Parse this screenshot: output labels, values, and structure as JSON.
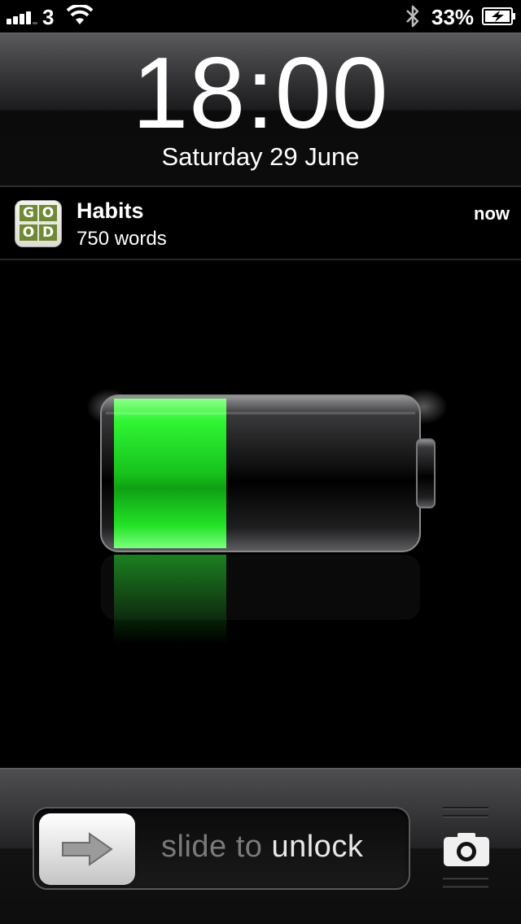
{
  "status_bar": {
    "carrier": "3",
    "battery_percent": "33%",
    "signal_bars": 4,
    "signal_max": 5,
    "icons": [
      "signal-icon",
      "wifi-icon",
      "bluetooth-icon",
      "battery-charging-icon"
    ]
  },
  "lock_screen": {
    "time": "18:00",
    "date": "Saturday 29 June"
  },
  "notification": {
    "app_name": "Habits",
    "message": "750 words",
    "timestamp": "now",
    "icon_letters": [
      "G",
      "O",
      "O",
      "D"
    ]
  },
  "charging": {
    "battery_level": 0.33,
    "fill_color": "#22e02a"
  },
  "unlock": {
    "slide_prefix": "slide to ",
    "slide_highlight": "unlock",
    "icons": [
      "arrow-right-icon",
      "camera-icon"
    ]
  },
  "colors": {
    "accent_green": "#22e02a",
    "habits_icon_green": "#6f8a36"
  }
}
